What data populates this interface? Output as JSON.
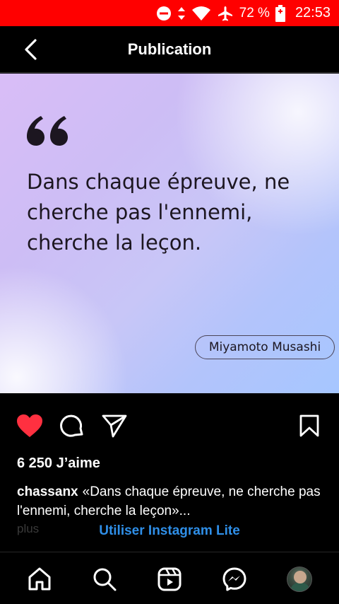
{
  "status_bar": {
    "battery": "72 %",
    "time": "22:53",
    "icons": [
      "do-not-disturb-icon",
      "data-arrows-icon",
      "wifi-icon",
      "airplane-icon",
      "battery-charging-icon"
    ],
    "background_color": "#ff0000"
  },
  "header": {
    "title": "Publication",
    "back_icon": "chevron-left-icon"
  },
  "post": {
    "quote": "Dans chaque épreuve, ne cherche pas l'ennemi, cherche la leçon.",
    "author": "Miyamoto Musashi"
  },
  "actions": {
    "like_icon": "heart-icon",
    "liked": true,
    "like_color": "#ff3040",
    "comment_icon": "comment-icon",
    "share_icon": "send-icon",
    "save_icon": "bookmark-icon"
  },
  "likes": "6 250 J’aime",
  "caption": {
    "username": "chassanx",
    "text": "«Dans chaque épreuve, ne cherche pas l'ennemi, cherche la leçon»...",
    "more": "plus"
  },
  "banner": {
    "link": "Utiliser Instagram Lite",
    "color": "#2f8fe8"
  },
  "bottom_nav": [
    "home-icon",
    "search-icon",
    "reels-icon",
    "messenger-icon",
    "profile-avatar"
  ]
}
